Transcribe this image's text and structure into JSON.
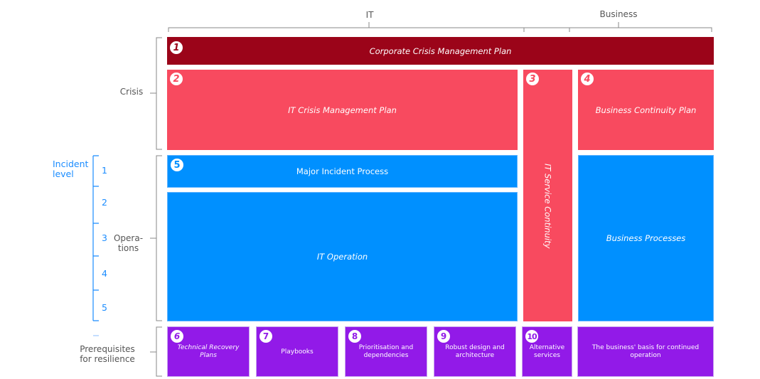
{
  "header": {
    "it_label": "IT",
    "business_label": "Business"
  },
  "side_labels": {
    "crisis": "Crisis",
    "operations": "Opera-\ntions",
    "prerequisites": "Prerequisites\nfor resilience",
    "incident_level_title": "Incident\nlevel",
    "incident_levels": [
      "1",
      "2",
      "3",
      "4",
      "5"
    ]
  },
  "colors": {
    "corporate": "#9b0419",
    "crisis": "#f84a5f",
    "operations": "#0090ff",
    "prerequisites": "#921ae8",
    "incident_level": "#1a8cff"
  },
  "boxes": [
    {
      "number": "1",
      "label": "Corporate Crisis Management Plan"
    },
    {
      "number": "2",
      "label": "IT Crisis Management Plan"
    },
    {
      "number": "3",
      "label": "IT Service Continuity"
    },
    {
      "number": "4",
      "label": "Business Continuity Plan"
    },
    {
      "number": "5",
      "label": "Major Incident Process"
    },
    {
      "number": "",
      "label": "IT Operation"
    },
    {
      "number": "",
      "label": "Business Processes"
    },
    {
      "number": "6",
      "label": "Technical Recovery Plans"
    },
    {
      "number": "7",
      "label": "Playbooks"
    },
    {
      "number": "8",
      "label": "Prioritisation and dependencies"
    },
    {
      "number": "9",
      "label": "Robust design and architecture"
    },
    {
      "number": "10",
      "label": "Alternative services"
    },
    {
      "number": "",
      "label": "The business' basis for continued operation"
    }
  ]
}
